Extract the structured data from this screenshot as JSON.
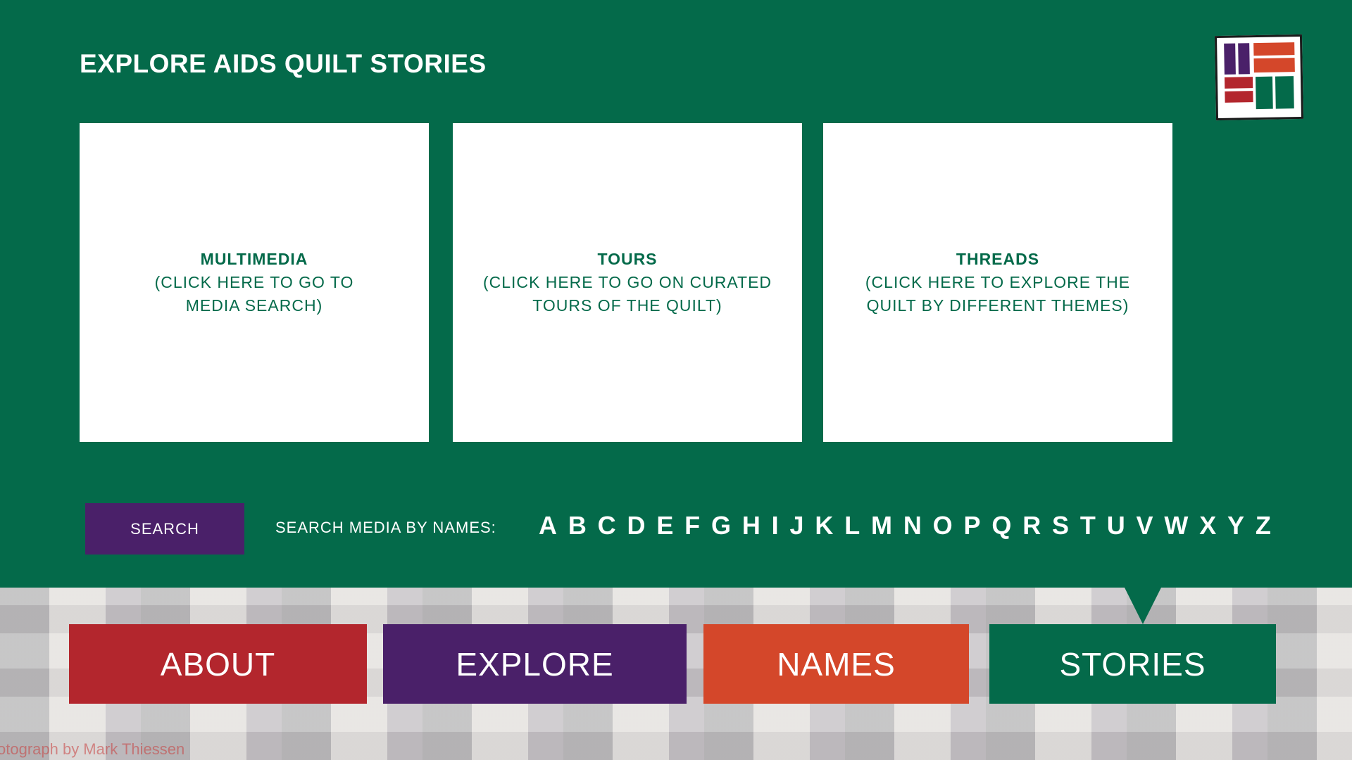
{
  "page": {
    "title": "EXPLORE AIDS QUILT STORIES"
  },
  "cards": [
    {
      "title": "MULTIMEDIA",
      "line1": "(CLICK HERE TO GO TO",
      "line2": "MEDIA SEARCH)"
    },
    {
      "title": "TOURS",
      "line1": "(CLICK HERE TO GO ON CURATED",
      "line2": "TOURS OF THE QUILT)"
    },
    {
      "title": "THREADS",
      "line1": "(CLICK HERE TO EXPLORE THE",
      "line2": "QUILT BY DIFFERENT THEMES)"
    }
  ],
  "search": {
    "button_label": "SEARCH",
    "by_names_label": "SEARCH MEDIA BY NAMES:",
    "letters": [
      "A",
      "B",
      "C",
      "D",
      "E",
      "F",
      "G",
      "H",
      "I",
      "J",
      "K",
      "L",
      "M",
      "N",
      "O",
      "P",
      "Q",
      "R",
      "S",
      "T",
      "U",
      "V",
      "W",
      "X",
      "Y",
      "Z"
    ]
  },
  "nav": {
    "about": "ABOUT",
    "explore": "EXPLORE",
    "names": "NAMES",
    "stories": "STORIES",
    "active": "stories"
  },
  "footer": {
    "credit": "otograph by Mark Thiessen"
  },
  "colors": {
    "green": "#046a4a",
    "red": "#b3262d",
    "purple": "#4a2069",
    "orange": "#d4472a",
    "white": "#ffffff"
  },
  "icons": {
    "logo": "quilt-logo-icon"
  }
}
